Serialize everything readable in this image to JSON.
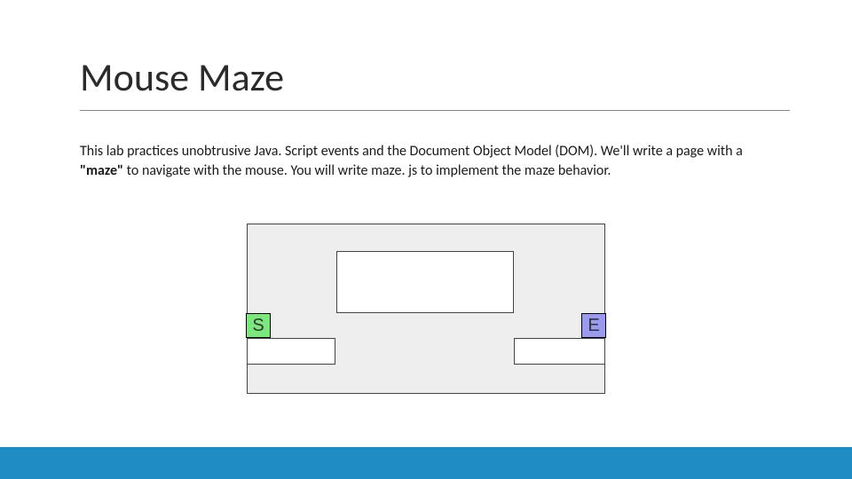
{
  "title": "Mouse Maze",
  "body_pre": "This lab practices unobtrusive Java. Script events and the Document Object Model (DOM). We'll write a page with a ",
  "body_bold": "\"maze\"",
  "body_post": " to navigate with the mouse. You will write maze. js to implement the maze behavior.",
  "maze": {
    "start_label": "S",
    "end_label": "E"
  },
  "colors": {
    "start": "#7be87b",
    "end": "#9a9af0",
    "footer": "#1f8dc4"
  }
}
